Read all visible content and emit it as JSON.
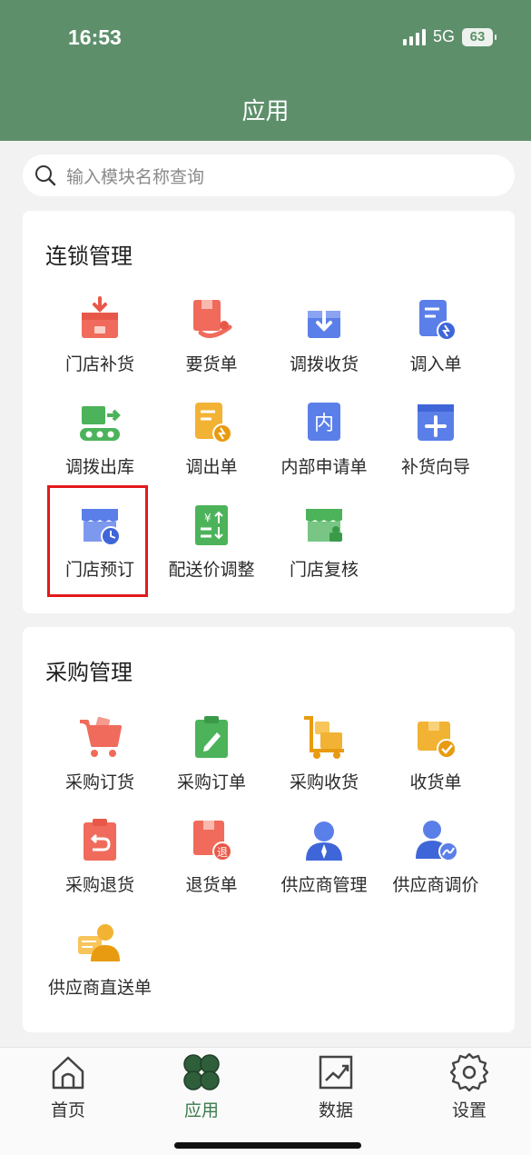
{
  "status_bar": {
    "time": "16:53",
    "network": "5G",
    "battery": "63"
  },
  "header": {
    "title": "应用"
  },
  "search": {
    "placeholder": "输入模块名称查询"
  },
  "sections": [
    {
      "title": "连锁管理",
      "items": [
        {
          "label": "门店补货",
          "icon": "store-restock-icon"
        },
        {
          "label": "要货单",
          "icon": "request-order-icon"
        },
        {
          "label": "调拨收货",
          "icon": "transfer-receive-icon"
        },
        {
          "label": "调入单",
          "icon": "transfer-in-icon"
        },
        {
          "label": "调拨出库",
          "icon": "transfer-out-icon"
        },
        {
          "label": "调出单",
          "icon": "outbound-order-icon"
        },
        {
          "label": "内部申请单",
          "icon": "internal-request-icon"
        },
        {
          "label": "补货向导",
          "icon": "restock-wizard-icon"
        },
        {
          "label": "门店预订",
          "icon": "store-reservation-icon"
        },
        {
          "label": "配送价调整",
          "icon": "delivery-price-icon"
        },
        {
          "label": "门店复核",
          "icon": "store-review-icon"
        }
      ]
    },
    {
      "title": "采购管理",
      "items": [
        {
          "label": "采购订货",
          "icon": "purchase-cart-icon"
        },
        {
          "label": "采购订单",
          "icon": "purchase-order-icon"
        },
        {
          "label": "采购收货",
          "icon": "purchase-receive-icon"
        },
        {
          "label": "收货单",
          "icon": "receipt-icon"
        },
        {
          "label": "采购退货",
          "icon": "purchase-return-icon"
        },
        {
          "label": "退货单",
          "icon": "return-order-icon"
        },
        {
          "label": "供应商管理",
          "icon": "supplier-manage-icon"
        },
        {
          "label": "供应商调价",
          "icon": "supplier-price-icon"
        },
        {
          "label": "供应商直送单",
          "icon": "supplier-direct-icon"
        }
      ]
    }
  ],
  "tabs": [
    {
      "label": "首页",
      "icon": "home-icon",
      "active": false
    },
    {
      "label": "应用",
      "icon": "apps-icon",
      "active": true
    },
    {
      "label": "数据",
      "icon": "data-chart-icon",
      "active": false
    },
    {
      "label": "设置",
      "icon": "settings-gear-icon",
      "active": false
    }
  ],
  "colors": {
    "header": "#5d8f6b",
    "accent": "#3b7a4a",
    "highlight": "#e21a1a"
  }
}
